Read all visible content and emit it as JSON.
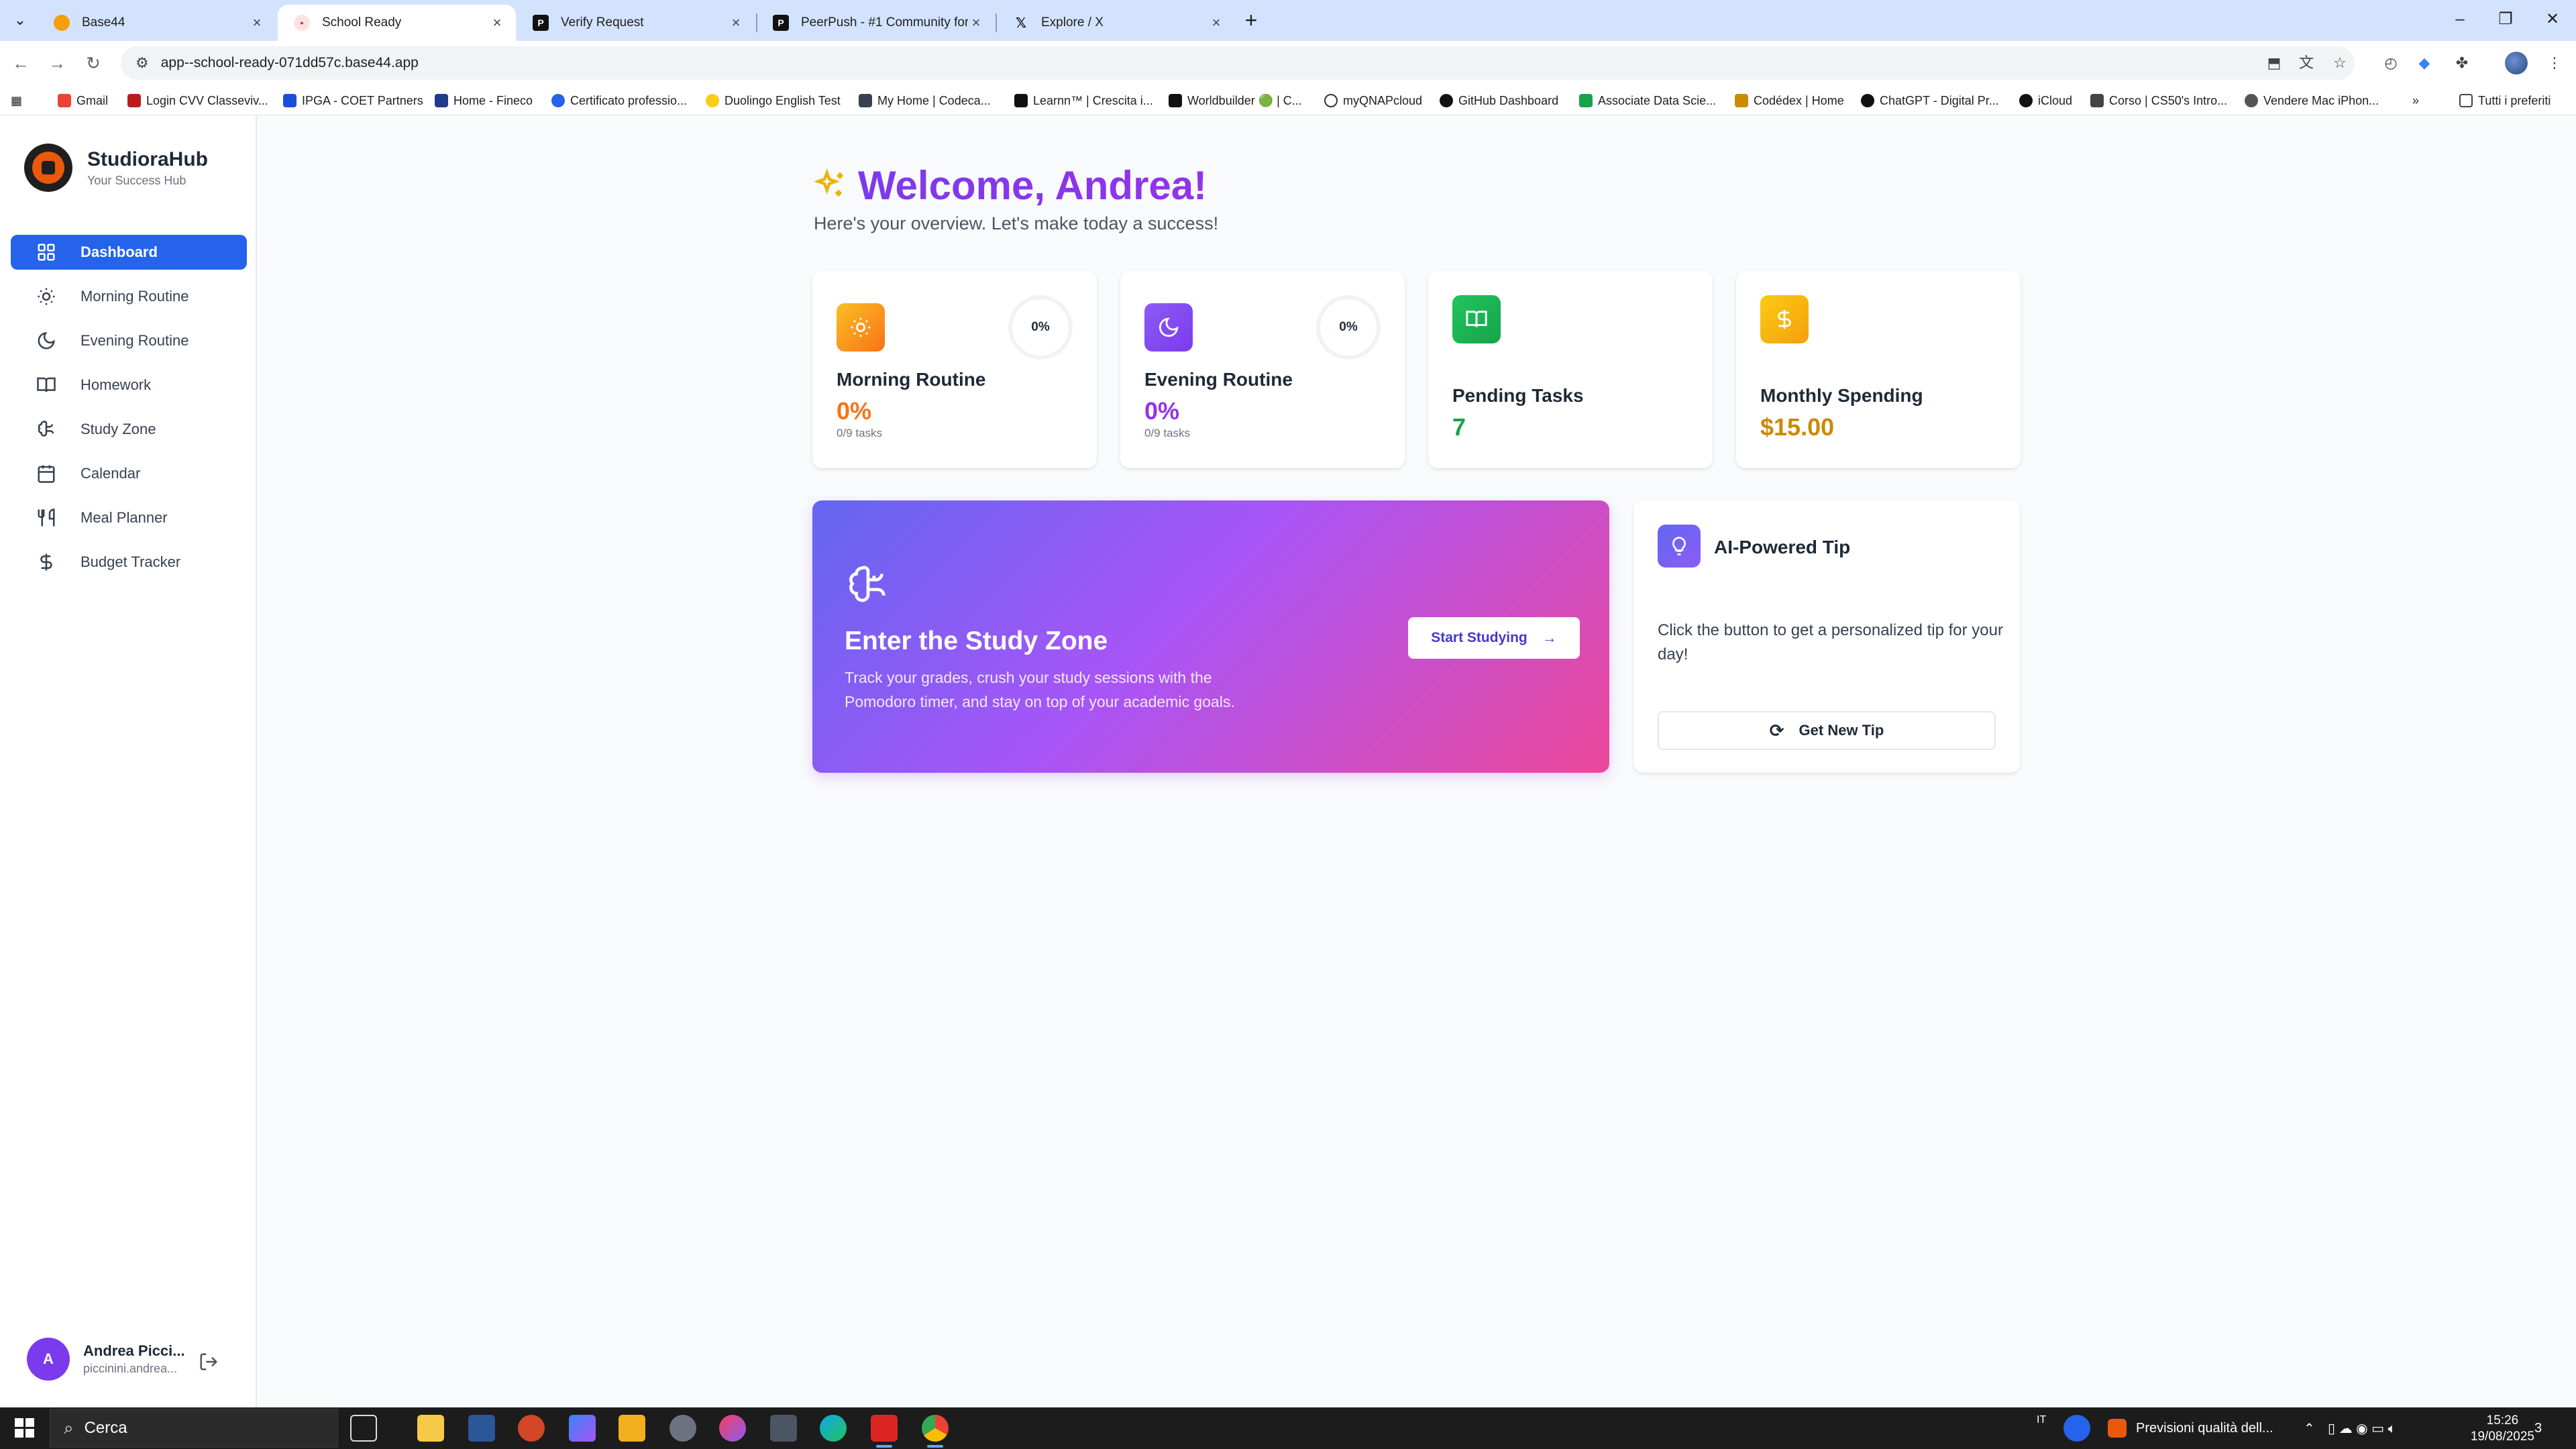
{
  "browser": {
    "tabs": [
      {
        "title": "Base44",
        "active": false
      },
      {
        "title": "School Ready",
        "active": true
      },
      {
        "title": "Verify Request",
        "active": false
      },
      {
        "title": "PeerPush - #1 Community for I",
        "active": false
      },
      {
        "title": "Explore / X",
        "active": false
      }
    ],
    "url": "app--school-ready-071dd57c.base44.app",
    "bookmarks": [
      "Gmail",
      "Login CVV Classeviv...",
      "IPGA - COET Partners",
      "Home - Fineco",
      "Certificato professio...",
      "Duolingo English Test",
      "My Home | Codeca...",
      "Learnn™ | Crescita i...",
      "Worldbuilder 🟢 | C...",
      "myQNAPcloud",
      "GitHub Dashboard",
      "Associate Data Scie...",
      "Codédex | Home",
      "ChatGPT - Digital Pr...",
      "iCloud",
      "Corso | CS50's Intro...",
      "Vendere Mac iPhon..."
    ],
    "all_bookmarks_label": "Tutti i preferiti"
  },
  "sidebar": {
    "brand_name": "StudioraHub",
    "brand_sub": "Your Success Hub",
    "items": [
      {
        "label": "Dashboard",
        "icon": "grid-icon"
      },
      {
        "label": "Morning Routine",
        "icon": "sun-icon"
      },
      {
        "label": "Evening Routine",
        "icon": "moon-icon"
      },
      {
        "label": "Homework",
        "icon": "book-icon"
      },
      {
        "label": "Study Zone",
        "icon": "brain-icon"
      },
      {
        "label": "Calendar",
        "icon": "calendar-icon"
      },
      {
        "label": "Meal Planner",
        "icon": "utensils-icon"
      },
      {
        "label": "Budget Tracker",
        "icon": "dollar-icon"
      }
    ],
    "user": {
      "initial": "A",
      "name": "Andrea Picci...",
      "email": "piccinini.andrea..."
    }
  },
  "main": {
    "welcome": "Welcome, Andrea!",
    "subtitle": "Here's your overview. Let's make today a success!",
    "cards": {
      "morning": {
        "title": "Morning Routine",
        "value": "0%",
        "ring": "0%",
        "sub": "0/9 tasks",
        "color": "#f97316"
      },
      "evening": {
        "title": "Evening Routine",
        "value": "0%",
        "ring": "0%",
        "sub": "0/9 tasks",
        "color": "#9333ea"
      },
      "pending": {
        "title": "Pending Tasks",
        "value": "7",
        "color": "#16a34a"
      },
      "spending": {
        "title": "Monthly Spending",
        "value": "$15.00",
        "color": "#ca8a04"
      }
    },
    "study": {
      "title": "Enter the Study Zone",
      "body": "Track your grades, crush your study sessions with the Pomodoro timer, and stay on top of your academic goals.",
      "button": "Start Studying"
    },
    "tip": {
      "title": "AI-Powered Tip",
      "body": "Click the button to get a personalized tip for your day!",
      "button": "Get New Tip"
    }
  },
  "taskbar": {
    "search_placeholder": "Cerca",
    "lang": "IT",
    "weather": "Previsioni qualità dell...",
    "time": "15:26",
    "date": "19/08/2025",
    "notifications": "3"
  }
}
